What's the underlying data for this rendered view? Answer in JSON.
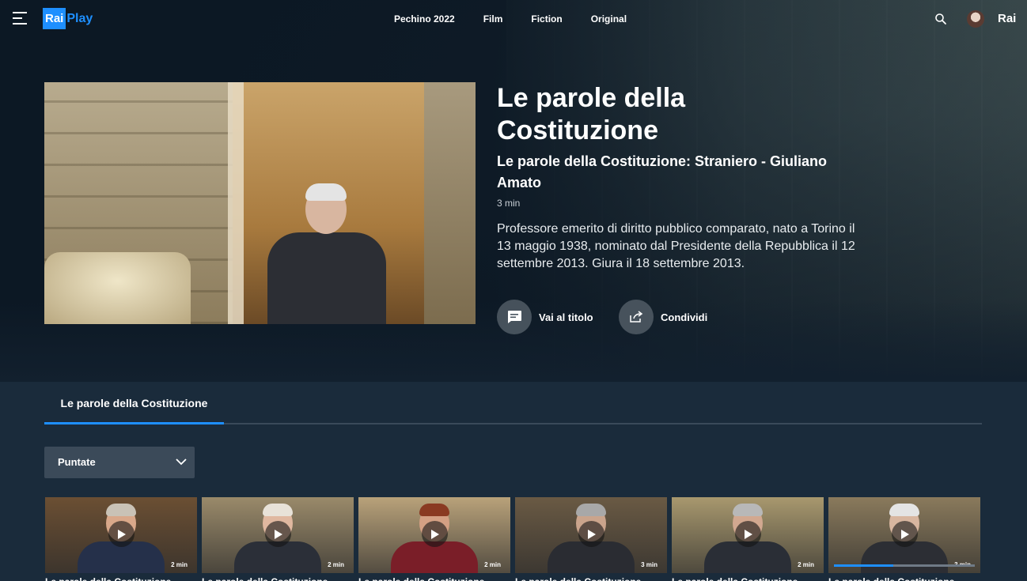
{
  "header": {
    "logo_rai": "Rai",
    "logo_play": "Play",
    "nav": [
      "Pechino 2022",
      "Film",
      "Fiction",
      "Original"
    ],
    "brand": "Rai"
  },
  "hero": {
    "title": "Le parole della Costituzione",
    "subtitle": "Le parole della Costituzione: Straniero - Giuliano Amato",
    "duration": "3 min",
    "description": "Professore emerito di diritto pubblico comparato, nato a Torino il 13 maggio 1938, nominato dal Presidente della Repubblica il 12 settembre 2013. Giura il 18 settembre 2013.",
    "actions": {
      "go_to_title": "Vai al titolo",
      "share": "Condividi"
    }
  },
  "tabs": {
    "active": "Le parole della Costituzione"
  },
  "dropdown": {
    "selected": "Puntate"
  },
  "cards": [
    {
      "duration": "2 min",
      "title": "Le parole della Costituzione",
      "progress": null,
      "skin": "#d9a88a",
      "hair": "#c9c2b6",
      "suit": "#25304a",
      "bg": "#6b4f33"
    },
    {
      "duration": "2 min",
      "title": "Le parole della Costituzione",
      "progress": null,
      "skin": "#e0b8a0",
      "hair": "#e8e2d8",
      "suit": "#2b2f38",
      "bg": "#9a8a6a"
    },
    {
      "duration": "2 min",
      "title": "Le parole della Costituzione",
      "progress": null,
      "skin": "#d4a084",
      "hair": "#8a3a22",
      "suit": "#7a1e28",
      "bg": "#b9a27a"
    },
    {
      "duration": "3 min",
      "title": "Le parole della Costituzione",
      "progress": null,
      "skin": "#caa48c",
      "hair": "#a8a8a8",
      "suit": "#2a2c32",
      "bg": "#6a5a44"
    },
    {
      "duration": "2 min",
      "title": "Le parole della Costituzione",
      "progress": null,
      "skin": "#d2a890",
      "hair": "#b8b8b8",
      "suit": "#2a2e36",
      "bg": "#a8986e"
    },
    {
      "duration": "3 min",
      "title": "Le parole della Costituzione",
      "progress": 0.42,
      "skin": "#d8b6a0",
      "hair": "#e4e4e4",
      "suit": "#2c2e34",
      "bg": "#8a7a5c"
    }
  ],
  "colors": {
    "accent": "#1e8fff",
    "background": "#1a2b3b"
  }
}
